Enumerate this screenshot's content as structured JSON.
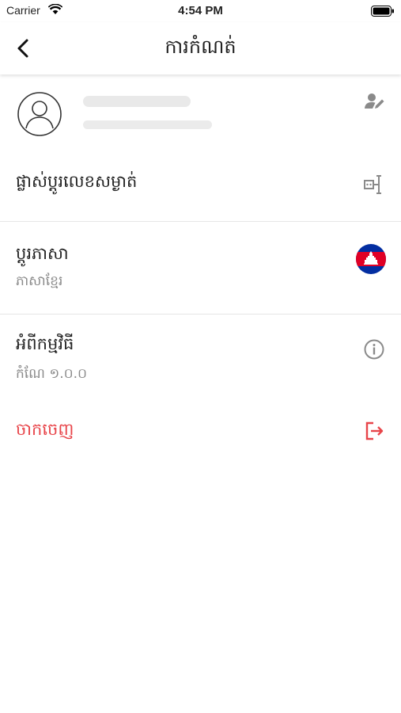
{
  "status_bar": {
    "carrier": "Carrier",
    "time": "4:54 PM"
  },
  "nav": {
    "title": "ការកំណត់"
  },
  "menu": {
    "change_password": {
      "label": "ផ្លាស់ប្តូរលេខសម្ងាត់"
    },
    "language": {
      "label": "ប្តូរភាសា",
      "value": "ភាសាខ្មែរ"
    },
    "about": {
      "label": "អំពីកម្មវិធី",
      "version": "កំណែ ១.០.០"
    },
    "logout": {
      "label": "ចាកចេញ"
    }
  },
  "colors": {
    "logout": "#e8454a",
    "flag_blue": "#032ea1",
    "flag_red": "#e00025"
  }
}
